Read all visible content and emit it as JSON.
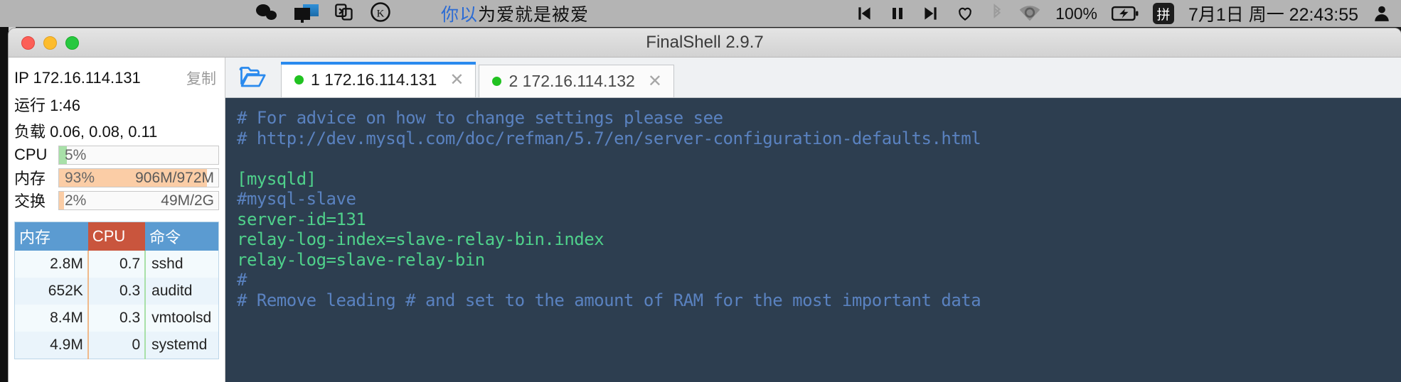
{
  "menubar": {
    "icons_left": [
      "wechat-icon",
      "monitor-icon",
      "screen-share-icon",
      "keka-icon"
    ],
    "now_playing": {
      "highlight": "你以",
      "rest": "为爱就是被爱"
    },
    "media": {
      "prev": "⏮",
      "pause": "❙❙",
      "next": "⏭",
      "heart": "♡"
    },
    "bluetooth": "bluetooth-icon",
    "wifi": "wifi-icon",
    "battery_percent": "100%",
    "battery_state": "charging",
    "input_method": "拼",
    "datetime": "7月1日 周一  22:43:55",
    "user": "user-icon"
  },
  "window": {
    "title": "FinalShell 2.9.7",
    "traffic_lights": [
      "close",
      "minimize",
      "zoom"
    ]
  },
  "sidebar": {
    "ip_label": "IP 172.16.114.131",
    "copy_label": "复制",
    "uptime_label": "运行 1:46",
    "load_label": "负载 0.06, 0.08, 0.11",
    "meters": [
      {
        "name": "CPU",
        "label": "CPU",
        "percent": "5%",
        "percent_value": 5,
        "detail": "",
        "color": "green"
      },
      {
        "name": "memory",
        "label": "内存",
        "percent": "93%",
        "percent_value": 93,
        "detail": "906M/972M",
        "color": "orange"
      },
      {
        "name": "swap",
        "label": "交换",
        "percent": "2%",
        "percent_value": 2,
        "detail": "49M/2G",
        "color": "orange"
      }
    ],
    "process_table": {
      "headers": [
        "内存",
        "CPU",
        "命令"
      ],
      "rows": [
        {
          "mem": "2.8M",
          "cpu": "0.7",
          "cmd": "sshd"
        },
        {
          "mem": "652K",
          "cpu": "0.3",
          "cmd": "auditd"
        },
        {
          "mem": "8.4M",
          "cpu": "0.3",
          "cmd": "vmtoolsd"
        },
        {
          "mem": "4.9M",
          "cpu": "0",
          "cmd": "systemd"
        }
      ]
    }
  },
  "tabbar": {
    "folder_icon": "open-folder-icon",
    "tabs": [
      {
        "label": "1 172.16.114.131",
        "active": true,
        "close": "✕"
      },
      {
        "label": "2 172.16.114.132",
        "active": false,
        "close": "✕"
      }
    ]
  },
  "terminal": {
    "lines": [
      {
        "text": "# For advice on how to change settings please see",
        "type": "comment"
      },
      {
        "text": "# http://dev.mysql.com/doc/refman/5.7/en/server-configuration-defaults.html",
        "type": "comment"
      },
      {
        "text": "",
        "type": "blank"
      },
      {
        "text": "[mysqld]",
        "type": "code"
      },
      {
        "text": "#mysql-slave",
        "type": "comment"
      },
      {
        "text": "server-id=131",
        "type": "code"
      },
      {
        "text": "relay-log-index=slave-relay-bin.index",
        "type": "code"
      },
      {
        "text": "relay-log=slave-relay-bin",
        "type": "code"
      },
      {
        "text": "#",
        "type": "comment"
      },
      {
        "text": "# Remove leading # and set to the amount of RAM for the most important data",
        "type": "comment"
      }
    ]
  },
  "colors": {
    "accent_blue": "#2a8aee",
    "terminal_bg": "#2d3e50",
    "terminal_code": "#4fd18b",
    "terminal_comment": "#5a82c0",
    "meter_green": "#a8e0a8",
    "meter_orange": "#fbcda6",
    "table_header_blue": "#5b9bd1",
    "table_header_red": "#c9553d"
  }
}
